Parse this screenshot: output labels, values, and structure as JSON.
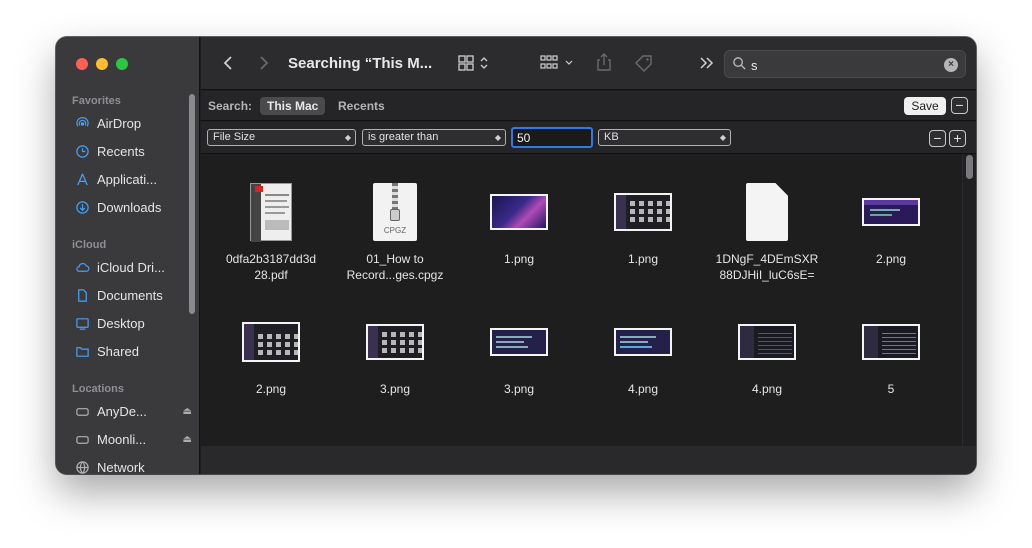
{
  "sidebar": {
    "sections": [
      {
        "title": "Favorites",
        "items": [
          {
            "label": "AirDrop",
            "icon": "airdrop-icon"
          },
          {
            "label": "Recents",
            "icon": "clock-icon"
          },
          {
            "label": "Applicati...",
            "icon": "applications-icon"
          },
          {
            "label": "Downloads",
            "icon": "download-icon"
          }
        ]
      },
      {
        "title": "iCloud",
        "items": [
          {
            "label": "iCloud Dri...",
            "icon": "cloud-icon"
          },
          {
            "label": "Documents",
            "icon": "document-icon"
          },
          {
            "label": "Desktop",
            "icon": "desktop-icon"
          },
          {
            "label": "Shared",
            "icon": "shared-folder-icon"
          }
        ]
      },
      {
        "title": "Locations",
        "items": [
          {
            "label": "AnyDe...",
            "icon": "drive-icon"
          },
          {
            "label": "Moonli...",
            "icon": "drive-icon"
          },
          {
            "label": "Network",
            "icon": "network-icon"
          }
        ]
      }
    ]
  },
  "toolbar": {
    "title": "Searching “This M...",
    "search_value": "s"
  },
  "scope": {
    "label": "Search:",
    "this_mac": "This Mac",
    "recents": "Recents",
    "save": "Save"
  },
  "criteria": {
    "attribute": "File Size",
    "operator": "is greater than",
    "value": "50",
    "unit": "KB"
  },
  "files": [
    {
      "name": "0dfa2b3187dd3d28.pdf",
      "line1": "0dfa2b3187dd3d",
      "line2": "28.pdf",
      "kind": "pdf"
    },
    {
      "name": "01_How to Record...ges.cpgz",
      "line1": "01_How to",
      "line2": "Record...ges.cpgz",
      "kind": "zip",
      "badge": "CPGZ"
    },
    {
      "name": "1.png",
      "line1": "1.png",
      "line2": "",
      "kind": "shot-purple"
    },
    {
      "name": "1.png",
      "line1": "1.png",
      "line2": "",
      "kind": "shot-grid"
    },
    {
      "name": "1DNgF_4DEmSXR88DJHiI_luC6sE=",
      "line1": "1DNgF_4DEmSXR",
      "line2": "88DJHiI_luC6sE=",
      "kind": "doc"
    },
    {
      "name": "2.png",
      "line1": "2.png",
      "line2": "",
      "kind": "shot-wide"
    },
    {
      "name": "2.png",
      "line1": "2.png",
      "line2": "",
      "kind": "shot-grid"
    },
    {
      "name": "3.png",
      "line1": "3.png",
      "line2": "",
      "kind": "shot-grid"
    },
    {
      "name": "3.png",
      "line1": "3.png",
      "line2": "",
      "kind": "shot-list"
    },
    {
      "name": "4.png",
      "line1": "4.png",
      "line2": "",
      "kind": "shot-list"
    },
    {
      "name": "4.png",
      "line1": "4.png",
      "line2": "",
      "kind": "shot-dark"
    },
    {
      "name": "5",
      "line1": "5",
      "line2": "",
      "kind": "shot-dark"
    }
  ],
  "colors": {
    "accent": "#2f7ae5",
    "window_bg": "#1e1e1e",
    "sidebar_bg": "#3a3a3c"
  }
}
